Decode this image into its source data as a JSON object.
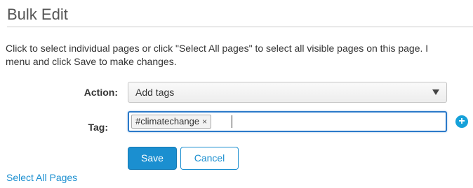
{
  "panel": {
    "title": "Bulk Edit",
    "instructions_line1": "Click to select individual pages or click \"Select All pages\" to select all visible pages on this page. I",
    "instructions_line2": "menu and click Save to make changes."
  },
  "form": {
    "action_label": "Action:",
    "action_value": "Add tags",
    "tag_label": "Tag:",
    "tags": [
      "#climatechange"
    ],
    "tag_remove_glyph": "×",
    "add_glyph": "+"
  },
  "buttons": {
    "save_label": "Save",
    "cancel_label": "Cancel"
  },
  "links": {
    "select_all_label": "Select All Pages"
  },
  "colors": {
    "accent": "#1b8fd0",
    "focus_border": "#2a79c9",
    "add_button": "#16a1d9"
  }
}
